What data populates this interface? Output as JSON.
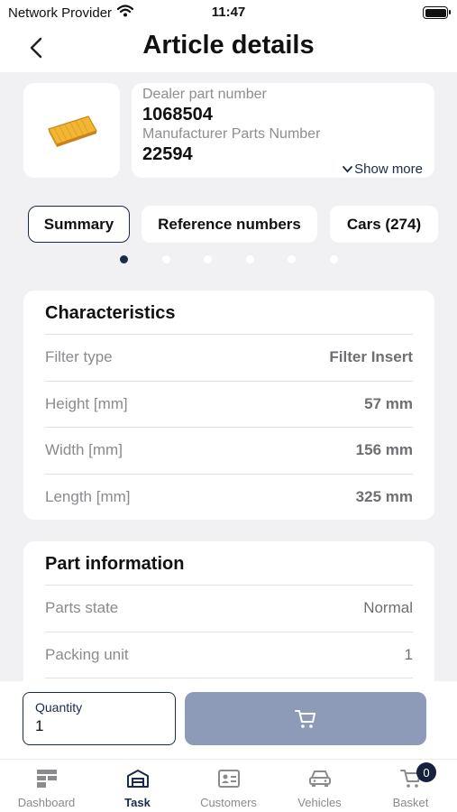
{
  "status_bar": {
    "carrier": "Network Provider",
    "time": "11:47"
  },
  "header": {
    "title": "Article details"
  },
  "product": {
    "dealer_part_label": "Dealer part number",
    "dealer_part_value": "1068504",
    "manufacturer_label": "Manufacturer Parts Number",
    "manufacturer_value": "22594",
    "show_more": "Show more"
  },
  "tabs": [
    {
      "label": "Summary",
      "active": true
    },
    {
      "label": "Reference numbers",
      "active": false
    },
    {
      "label": "Cars (274)",
      "active": false
    }
  ],
  "pager": {
    "count": 6,
    "active_index": 0
  },
  "characteristics": {
    "title": "Characteristics",
    "rows": [
      {
        "label": "Filter type",
        "value": "Filter Insert"
      },
      {
        "label": "Height [mm]",
        "value": "57 mm"
      },
      {
        "label": "Width [mm]",
        "value": "156 mm"
      },
      {
        "label": "Length [mm]",
        "value": "325 mm"
      }
    ]
  },
  "part_information": {
    "title": "Part information",
    "rows": [
      {
        "label": "Parts state",
        "value": "Normal"
      },
      {
        "label": "Packing unit",
        "value": "1"
      }
    ]
  },
  "quantity": {
    "label": "Quantity",
    "value": "1"
  },
  "colors": {
    "primary": "#1b2a4a",
    "cart_button": "#8e9bb8",
    "product_yellow": "#f2b632"
  },
  "bottom_nav": {
    "items": [
      {
        "label": "Dashboard",
        "icon": "dashboard-icon"
      },
      {
        "label": "Task",
        "icon": "task-icon",
        "active": true
      },
      {
        "label": "Customers",
        "icon": "customers-icon"
      },
      {
        "label": "Vehicles",
        "icon": "vehicles-icon"
      },
      {
        "label": "Basket",
        "icon": "basket-icon",
        "badge": "0"
      }
    ]
  }
}
